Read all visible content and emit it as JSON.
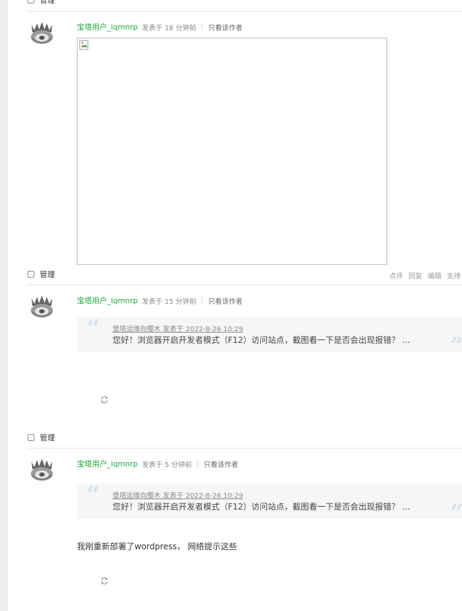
{
  "manage_label": "管理",
  "reply_1": {
    "username": "宝塔用户_iqmnrp",
    "posted_time": "发表于 18 分钟前",
    "only_author_label": "只看该作者",
    "actions": [
      "点评",
      "回复",
      "编辑",
      "支持"
    ]
  },
  "reply_2": {
    "username": "宝塔用户_iqmnrp",
    "posted_time": "发表于 15 分钟前",
    "only_author_label": "只看该作者",
    "quote": {
      "header": "堡塔运维向樱木 发表于 2022-8-26 10:29",
      "text": "您好！浏览器开启开发者模式（F12）访问站点，截图看一下是否会出现报错？ ..."
    }
  },
  "reply_3": {
    "username": "宝塔用户_iqmnrp",
    "posted_time": "发表于 5 分钟前",
    "only_author_label": "只看该作者",
    "quote": {
      "header": "堡塔运维向樱木 发表于 2022-8-26 10:29",
      "text": "您好！浏览器开启开发者模式（F12）访问站点，截图看一下是否会出现报错？ ..."
    },
    "message": "我刚重新部署了wordpress， 网络提示这些"
  },
  "colors": {
    "username": "#20a53a",
    "quote_marks": "#d6e2ec",
    "quote_background": "#f6f6f6"
  }
}
